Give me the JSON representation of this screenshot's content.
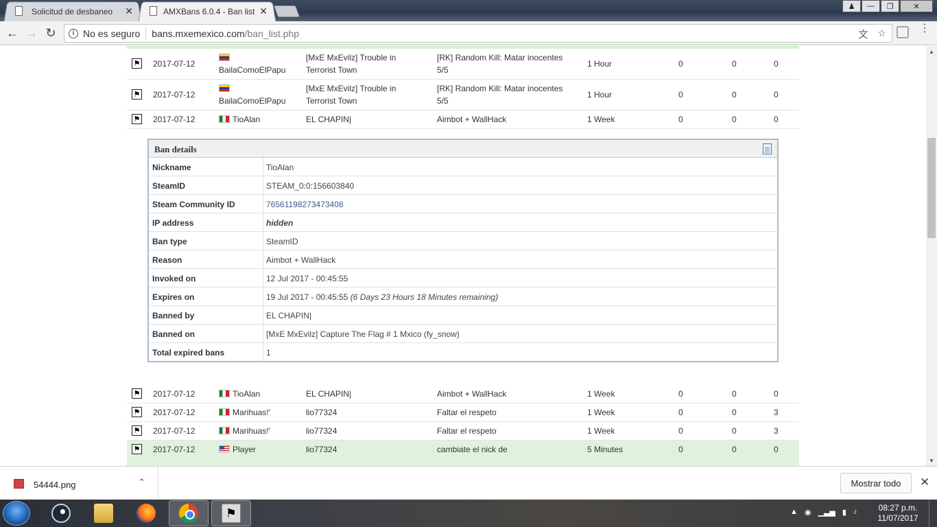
{
  "browser": {
    "tabs": [
      {
        "title": "Solicitud de desbaneo",
        "active": false
      },
      {
        "title": "AMXBans 6.0.4 - Ban list",
        "active": true
      }
    ],
    "security_label": "No es seguro",
    "url_host": "bans.mxemexico.com",
    "url_path": "/ban_list.php"
  },
  "bans_top": [
    {
      "date": "2017-07-12",
      "flag": "ve",
      "player": "BailaComoElPapu",
      "admin": "[MxE MxEvilz] Trouble in Terrorist Town",
      "reason": "[RK] Random Kill: Matar inocentes 5/5",
      "length": "1 Hour",
      "c1": "0",
      "c2": "0",
      "c3": "0"
    },
    {
      "date": "2017-07-12",
      "flag": "ve",
      "player": "BailaComoElPapu",
      "admin": "[MxE MxEvilz] Trouble in Terrorist Town",
      "reason": "[RK] Random Kill: Matar inocentes 5/5",
      "length": "1 Hour",
      "c1": "0",
      "c2": "0",
      "c3": "0"
    },
    {
      "date": "2017-07-12",
      "flag": "mx",
      "player": "TioAlan",
      "admin": "EL CHAPIN|",
      "reason": "Aimbot + WallHack",
      "length": "1 Week",
      "c1": "0",
      "c2": "0",
      "c3": "0"
    }
  ],
  "ban_details": {
    "title": "Ban details",
    "rows": [
      {
        "key": "Nickname",
        "value": "TioAlan"
      },
      {
        "key": "SteamID",
        "value": "STEAM_0:0:156603840"
      },
      {
        "key": "Steam Community ID",
        "value": "76561198273473408"
      },
      {
        "key": "IP address",
        "value": "hidden"
      },
      {
        "key": "Ban type",
        "value": "SteamID"
      },
      {
        "key": "Reason",
        "value": "Aimbot + WallHack"
      },
      {
        "key": "Invoked on",
        "value": "12 Jul 2017 - 00:45:55"
      },
      {
        "key": "Expires on",
        "value": "19 Jul 2017 - 00:45:55",
        "extra": "(6 Days 23 Hours 18 Minutes remaining)"
      },
      {
        "key": "Banned by",
        "value": "EL CHAPIN|"
      },
      {
        "key": "Banned on",
        "value": "[MxE MxEvilz] Capture The Flag # 1 Mxico (fy_snow)"
      },
      {
        "key": "Total expired bans",
        "value": "1"
      }
    ]
  },
  "bans_bottom": [
    {
      "date": "2017-07-12",
      "flag": "mx",
      "player": "TioAlan",
      "admin": "EL CHAPIN|",
      "reason": "Aimbot + WallHack",
      "length": "1 Week",
      "c1": "0",
      "c2": "0",
      "c3": "0"
    },
    {
      "date": "2017-07-12",
      "flag": "mx",
      "player": "Marihuas!'",
      "admin": "lio77324",
      "reason": "Faltar el respeto",
      "length": "1 Week",
      "c1": "0",
      "c2": "0",
      "c3": "3"
    },
    {
      "date": "2017-07-12",
      "flag": "mx",
      "player": "Marihuas!'",
      "admin": "lio77324",
      "reason": "Faltar el respeto",
      "length": "1 Week",
      "c1": "0",
      "c2": "0",
      "c3": "3"
    },
    {
      "date": "2017-07-12",
      "flag": "us",
      "player": "Player",
      "admin": "lio77324",
      "reason": "cambiate el nick de",
      "length": "5 Minutes",
      "c1": "0",
      "c2": "0",
      "c3": "0"
    }
  ],
  "downloads": {
    "file": "54444.png",
    "show_all": "Mostrar todo"
  },
  "taskbar": {
    "time": "08:27 p.m.",
    "date": "11/07/2017"
  }
}
